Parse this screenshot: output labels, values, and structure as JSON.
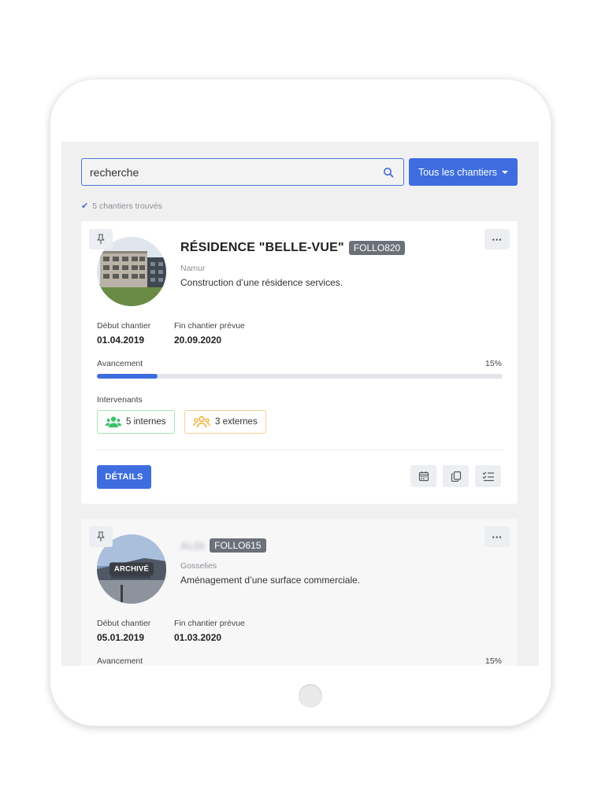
{
  "search": {
    "value": "recherche",
    "placeholder": "recherche"
  },
  "filter": {
    "label": "Tous les chantiers"
  },
  "results": {
    "count_text": "5 chantiers trouvés"
  },
  "labels": {
    "start": "Début chantier",
    "end": "Fin chantier prévue",
    "progress": "Avancement",
    "intervenants": "Intervenants",
    "details": "DÉTAILS",
    "more": "···",
    "archived": "ARCHIVÉ"
  },
  "projects": [
    {
      "title": "RÉSIDENCE \"BELLE-VUE\"",
      "code": "FOLLO820",
      "location": "Namur",
      "description": "Construction d’une résidence services.",
      "start_date": "01.04.2019",
      "end_date": "20.09.2020",
      "progress_text": "15%",
      "progress": 0.15,
      "internal": "5 internes",
      "external": "3 externes"
    },
    {
      "title": "ALDI",
      "code": "FOLLO615",
      "location": "Gosselies",
      "description": "Aménagement d’une surface commerciale.",
      "start_date": "05.01.2019",
      "end_date": "01.03.2020",
      "progress_text": "15%",
      "progress": 0.15,
      "archived": true
    }
  ],
  "colors": {
    "accent": "#3e6de0",
    "internal": "#3cc06b",
    "external": "#f5a623"
  },
  "icons": [
    "search-icon",
    "chevron-down-icon",
    "check-icon",
    "pin-icon",
    "ellipsis-icon",
    "users-icon",
    "group-icon",
    "calendar-icon",
    "copy-icon",
    "checklist-icon"
  ]
}
